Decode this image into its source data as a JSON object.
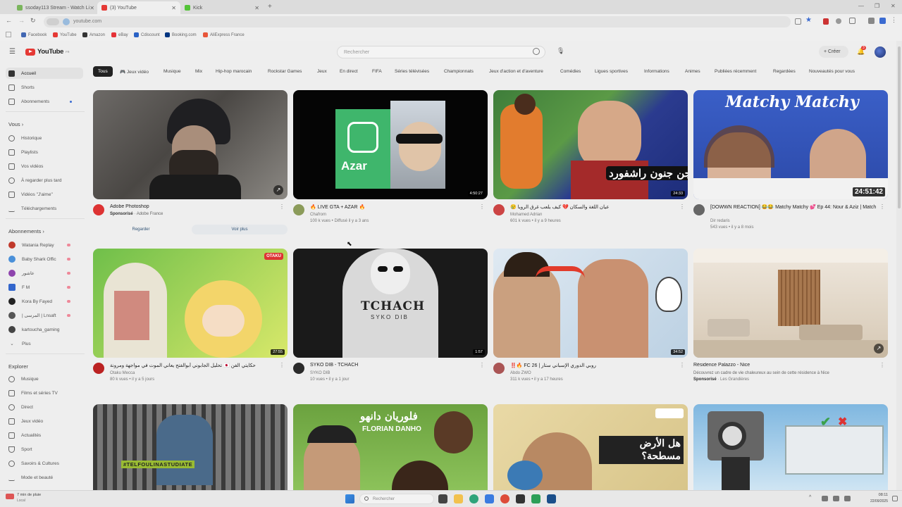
{
  "tabs": [
    {
      "label": "ssoday113 Stream - Watch Li",
      "color": "#7ab55c"
    },
    {
      "label": "(3) YouTube",
      "color": "#e53935"
    },
    {
      "label": "Kick",
      "color": "#53c337"
    }
  ],
  "address": {
    "url": "youtube.com"
  },
  "bookmarks": [
    {
      "label": "Facebook",
      "color": "#4267b2"
    },
    {
      "label": "YouTube",
      "color": "#e53935"
    },
    {
      "label": "Amazon",
      "color": "#333"
    },
    {
      "label": "eBay",
      "color": "#e53238"
    },
    {
      "label": "Cdiscount",
      "color": "#2a62c5"
    },
    {
      "label": "Booking.com",
      "color": "#003580"
    },
    {
      "label": "AliExpress France",
      "color": "#e8563a"
    }
  ],
  "youtube": {
    "logo": "YouTube",
    "logo_sup": "FR",
    "search_placeholder": "Rechercher",
    "create_label": "Créer",
    "notifications": "3"
  },
  "sidebar": {
    "main": [
      {
        "label": "Accueil",
        "icon": "home-icon"
      },
      {
        "label": "Shorts",
        "icon": "shorts-icon"
      },
      {
        "label": "Abonnements",
        "icon": "subscriptions-icon"
      }
    ],
    "you_heading": "Vous",
    "you": [
      {
        "label": "Historique",
        "icon": "history-icon"
      },
      {
        "label": "Playlists",
        "icon": "playlist-icon"
      },
      {
        "label": "Vos vidéos",
        "icon": "video-icon"
      },
      {
        "label": "À regarder plus tard",
        "icon": "clock-icon"
      },
      {
        "label": "Vidéos \"J'aime\"",
        "icon": "like-icon"
      },
      {
        "label": "Téléchargements",
        "icon": "download-icon"
      }
    ],
    "subs_heading": "Abonnements",
    "subs": [
      {
        "label": "Watania Replay",
        "color": "#c0392b"
      },
      {
        "label": "Baby Shark Offic",
        "color": "#4a90d9"
      },
      {
        "label": "عاشور",
        "color": "#8e44ad"
      },
      {
        "label": "F M",
        "color": "#3366cc"
      },
      {
        "label": "Kora By Fayed",
        "color": "#222"
      },
      {
        "label": "| المرسى | Lnsaft",
        "color": "#555"
      },
      {
        "label": "kartoucha_gaming",
        "color": "#444"
      },
      {
        "label": "Plus",
        "color": ""
      }
    ],
    "explore_heading": "Explorer",
    "explore": [
      {
        "label": "Musique",
        "icon": "music-icon"
      },
      {
        "label": "Films et séries TV",
        "icon": "film-icon"
      },
      {
        "label": "Direct",
        "icon": "live-icon"
      },
      {
        "label": "Jeux vidéo",
        "icon": "gaming-icon"
      },
      {
        "label": "Actualités",
        "icon": "news-icon"
      },
      {
        "label": "Sport",
        "icon": "trophy-icon"
      },
      {
        "label": "Savoirs & Cultures",
        "icon": "bulb-icon"
      },
      {
        "label": "Mode et beauté",
        "icon": "hanger-icon"
      }
    ]
  },
  "chips": [
    "Tous",
    "🎮 Jeux vidéo",
    "Musique",
    "Mix",
    "Hip-hop marocain",
    "Rockstar Games",
    "Jeux",
    "En direct",
    "FIFA",
    "Séries télévisées",
    "Championnats",
    "Jeux d'action et d'aventure",
    "Comédies",
    "Ligues sportives",
    "Informations",
    "Animes",
    "Publiées récemment",
    "Regardées",
    "Nouveautés pour vous"
  ],
  "videos": [
    {
      "title": "Adobe Photoshop",
      "sponsored": "Sponsorisé",
      "channel": "Adobe France",
      "views": "",
      "btn1": "Regarder",
      "btn2": "Voir plus",
      "duration": ""
    },
    {
      "title": "🔥 LIVE GTA + AZAR 🔥",
      "channel": "Chafrom",
      "views": "100 k vues • Diffusé il y a 3 ans",
      "duration": "4:50:27"
    },
    {
      "title": "😢 عيان اللغة والسكان 💔 كيف يلعب غرق الرويا ",
      "channel": "Mohamed Adrian",
      "views": "601 k vues • il y a 9 heures",
      "duration": "24:33"
    },
    {
      "title": "[DOWWN REACTION] 😂😂 Matchy Matchy 💕 Ep 44: Nour & Aziz | Match",
      "channel": "Dir redaris",
      "views": "543 vues • il y a 8 mois",
      "duration": "24:51:42"
    },
    {
      "title": "تحليل الجابوني أبوالفتح يعاني الموت في مواجهة ومرونة 🇯🇵 حكايتي الفن",
      "channel": "Otaku Mecca",
      "views": "80 k vues • il y a 5 jours",
      "duration": "27:55"
    },
    {
      "title": "SYKO DIB - TCHACH",
      "channel": "SYKO DIB",
      "views": "10 vues • il y a 1 jour",
      "duration": "1:57"
    },
    {
      "title": "‼️🔥 FC 26 | روبي الدوري الإسباني ستار",
      "channel": "Abdo ZWO",
      "views": "311 k vues • il y a 17 heures",
      "duration": "34:52"
    },
    {
      "title": "Résidence Palazzo - Nice",
      "desc": "Découvrez un cadre de vie chaleureux au sein de cette résidence à Nice",
      "sponsored": "Sponsorisé",
      "channel": "Les Grandières",
      "duration": ""
    }
  ],
  "thumb_text": {
    "azar": "Azar",
    "matchy": "Matchy Matchy",
    "tchach": "TCHACH",
    "syko": "SYKO DIB",
    "otaku": "OTAKU",
    "danho": "فلوريان دانهو",
    "danho2": "FLORIAN DANHO",
    "tel": "#TELFOULINASTUDIATE",
    "ardh": "هل الأرض مسطحة؟",
    "arabic3": "جن جنون راشفورد"
  },
  "taskbar": {
    "search": "Rechercher",
    "weather": "7 min de pluie",
    "weather2": "Local",
    "time": "08:11",
    "date": "22/09/2025"
  }
}
